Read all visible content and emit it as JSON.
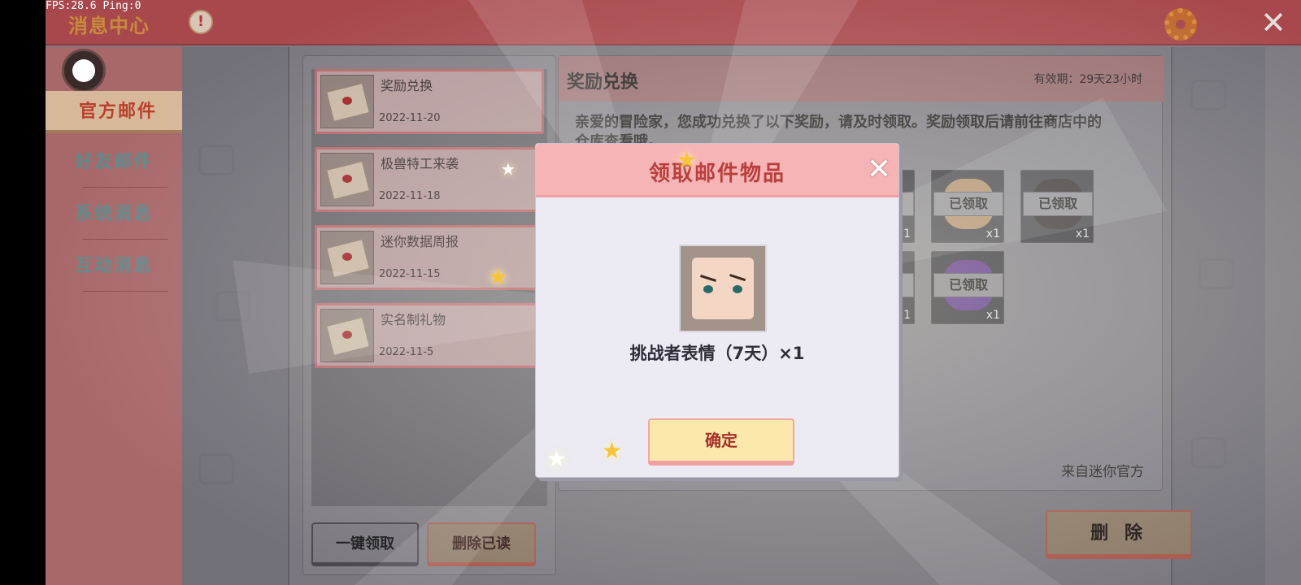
{
  "overlay": {
    "fps_text": "FPS:28.6  Ping:0"
  },
  "topbar": {
    "title": "消息中心",
    "badge": "!"
  },
  "sidebar": {
    "tabs": [
      {
        "label": "官方邮件",
        "active": true
      },
      {
        "label": "好友邮件",
        "active": false
      },
      {
        "label": "系统消息",
        "active": false
      },
      {
        "label": "互动消息",
        "active": false
      }
    ]
  },
  "mail_list": {
    "items": [
      {
        "title": "奖励兑换",
        "date": "2022-11-20"
      },
      {
        "title": "极兽特工来袭",
        "date": "2022-11-18"
      },
      {
        "title": "迷你数据周报",
        "date": "2022-11-15"
      },
      {
        "title": "实名制礼物",
        "date": "2022-11-5"
      }
    ],
    "claim_all_label": "一键领取",
    "delete_read_label": "删除已读"
  },
  "detail": {
    "title": "奖励兑换",
    "validity": "有效期：29天23小时",
    "body": "亲爱的冒险家，您成功兑换了以下奖励，请及时领取。奖励领取后请前往商店中的仓库查看哦。",
    "sender": "来自迷你官方",
    "rewards": [
      {
        "tag": "已领取",
        "count": "x1",
        "color": "#4a6aa0"
      },
      {
        "tag": "已领取",
        "count": "x1",
        "color": "#c89a6a"
      },
      {
        "tag": "已领取",
        "count": "x1",
        "color": "#2a2222"
      },
      {
        "tag": "已领取",
        "count": "x1",
        "color": "#d86a2a"
      },
      {
        "tag": "已领取",
        "count": "x1",
        "color": "#6a3aa0"
      }
    ],
    "delete_label": "删 除"
  },
  "modal": {
    "title": "领取邮件物品",
    "item_name": "挑战者表情（7天）×1",
    "confirm_label": "确定"
  }
}
